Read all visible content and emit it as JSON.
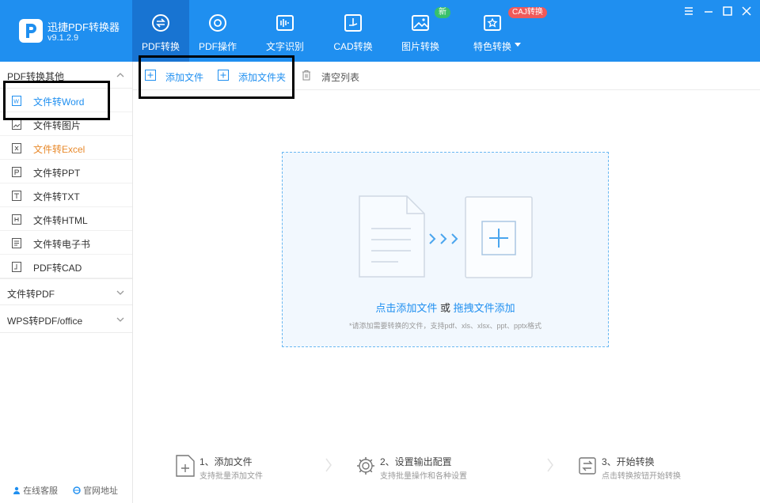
{
  "app": {
    "name": "迅捷PDF转换器",
    "version": "v9.1.2.9"
  },
  "nav": {
    "tabs": [
      {
        "label": "PDF转换",
        "icon": "pdf-convert-icon"
      },
      {
        "label": "PDF操作",
        "icon": "pdf-operate-icon"
      },
      {
        "label": "文字识别",
        "icon": "ocr-icon"
      },
      {
        "label": "CAD转换",
        "icon": "cad-icon"
      },
      {
        "label": "图片转换",
        "icon": "image-icon"
      },
      {
        "label": "特色转换",
        "icon": "special-icon"
      }
    ],
    "badges": {
      "new": "新",
      "caj": "CAJ转换"
    }
  },
  "sidebar": {
    "group1": {
      "label": "PDF转换其他"
    },
    "items": [
      {
        "label": "文件转Word"
      },
      {
        "label": "文件转图片"
      },
      {
        "label": "文件转Excel"
      },
      {
        "label": "文件转PPT"
      },
      {
        "label": "文件转TXT"
      },
      {
        "label": "文件转HTML"
      },
      {
        "label": "文件转电子书"
      },
      {
        "label": "PDF转CAD"
      }
    ],
    "group2": {
      "label": "文件转PDF"
    },
    "group3": {
      "label": "WPS转PDF/office"
    },
    "footer": {
      "service": "在线客服",
      "website": "官网地址"
    }
  },
  "toolbar": {
    "add_file": "添加文件",
    "add_folder": "添加文件夹",
    "clear_list": "清空列表"
  },
  "dropzone": {
    "link1": "点击添加文件",
    "or": " 或 ",
    "link2": "拖拽文件添加",
    "hint": "*请添加需要转换的文件，支持pdf、xls、xlsx、ppt、pptx格式"
  },
  "steps": [
    {
      "title": "1、添加文件",
      "desc": "支持批量添加文件"
    },
    {
      "title": "2、设置输出配置",
      "desc": "支持批量操作和各种设置"
    },
    {
      "title": "3、开始转换",
      "desc": "点击转换按钮开始转换"
    }
  ],
  "colors": {
    "brand": "#1f8ff0",
    "active_tab": "#1874d2",
    "excel_item": "#e88a2c"
  }
}
